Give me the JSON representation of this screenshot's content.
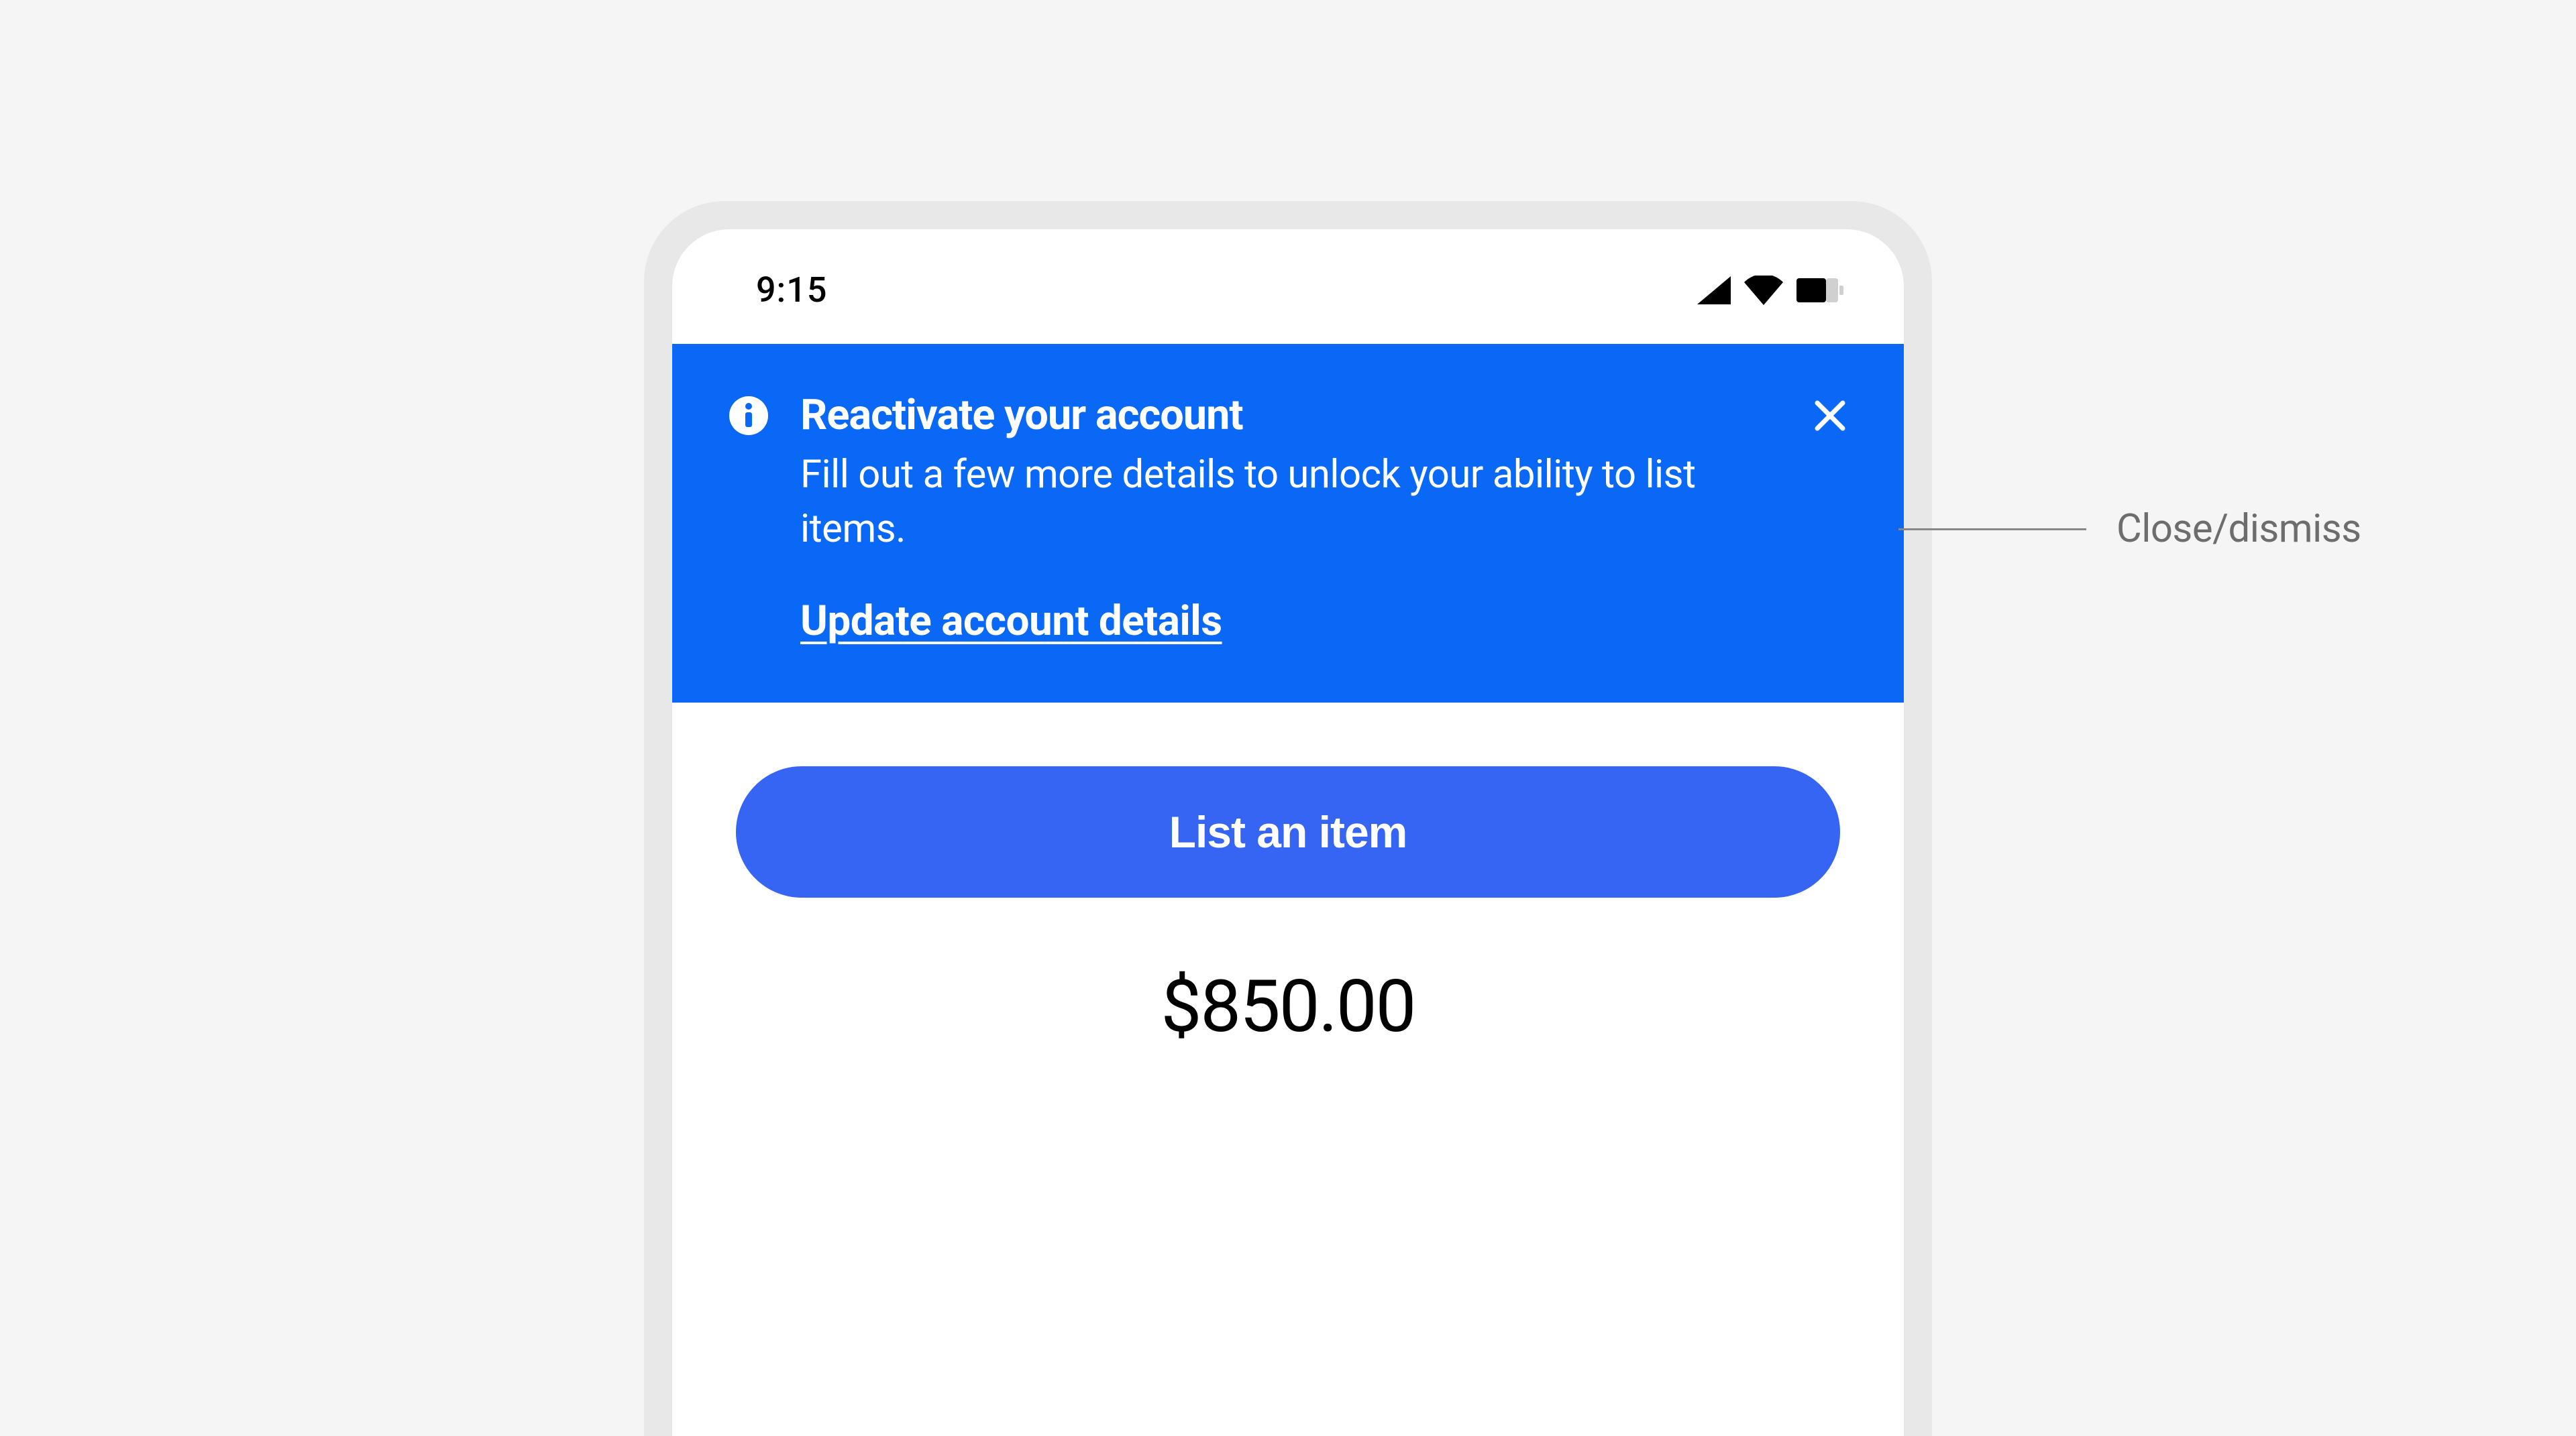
{
  "status_bar": {
    "time": "9:15"
  },
  "banner": {
    "title": "Reactivate your account",
    "description": "Fill out a few more details to unlock your ability to list items.",
    "link_label": "Update account details"
  },
  "main": {
    "primary_button_label": "List an item",
    "price": "$850.00"
  },
  "annotation": {
    "close_label": "Close/dismiss"
  }
}
